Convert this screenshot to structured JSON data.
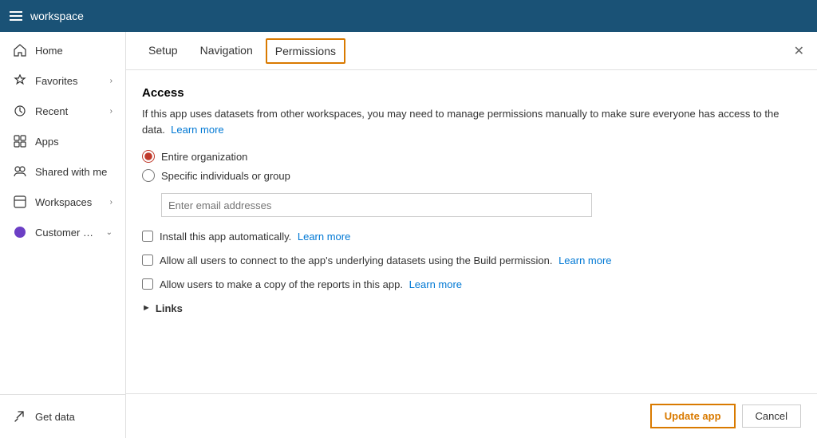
{
  "topbar": {
    "title": "workspace"
  },
  "sidebar": {
    "items": [
      {
        "id": "home",
        "label": "Home",
        "icon": "home-icon",
        "hasChevron": false
      },
      {
        "id": "favorites",
        "label": "Favorites",
        "icon": "favorites-icon",
        "hasChevron": true
      },
      {
        "id": "recent",
        "label": "Recent",
        "icon": "recent-icon",
        "hasChevron": true
      },
      {
        "id": "apps",
        "label": "Apps",
        "icon": "apps-icon",
        "hasChevron": false
      },
      {
        "id": "shared",
        "label": "Shared with me",
        "icon": "shared-icon",
        "hasChevron": false
      },
      {
        "id": "workspaces",
        "label": "Workspaces",
        "icon": "workspaces-icon",
        "hasChevron": true
      },
      {
        "id": "customer",
        "label": "Customer Service A...",
        "icon": "customer-icon",
        "hasChevron": true
      }
    ],
    "bottom": {
      "label": "Get data",
      "icon": "get-data-icon"
    }
  },
  "tabs": [
    {
      "id": "setup",
      "label": "Setup"
    },
    {
      "id": "navigation",
      "label": "Navigation"
    },
    {
      "id": "permissions",
      "label": "Permissions"
    }
  ],
  "activeTab": "permissions",
  "panel": {
    "accessTitle": "Access",
    "infoText": "If this app uses datasets from other workspaces, you may need to manage permissions manually to make sure everyone has access to the data.",
    "learnMoreLink": "Learn more",
    "radioOptions": [
      {
        "id": "entire-org",
        "label": "Entire organization",
        "selected": true
      },
      {
        "id": "specific",
        "label": "Specific individuals or group",
        "selected": false
      }
    ],
    "emailPlaceholder": "Enter email addresses",
    "checkboxOptions": [
      {
        "id": "install-auto",
        "label": "Install this app automatically.",
        "learnMore": "Learn more"
      },
      {
        "id": "allow-build",
        "label": "Allow all users to connect to the app's underlying datasets using the Build permission.",
        "learnMore": "Learn more"
      },
      {
        "id": "allow-copy",
        "label": "Allow users to make a copy of the reports in this app.",
        "learnMore": "Learn more"
      }
    ],
    "linksLabel": "Links"
  },
  "footer": {
    "updateLabel": "Update app",
    "cancelLabel": "Cancel"
  }
}
